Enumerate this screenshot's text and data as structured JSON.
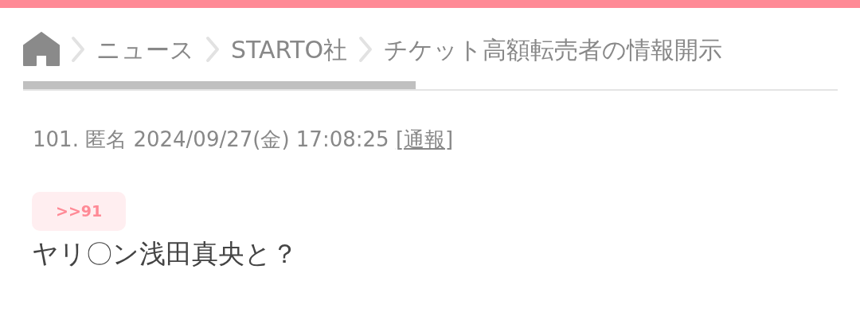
{
  "breadcrumb": [
    {
      "kind": "home"
    },
    {
      "kind": "link",
      "label": "ニュース"
    },
    {
      "kind": "link",
      "label": "STARTO社"
    },
    {
      "kind": "text",
      "label": "チケット高額転売者の情報開示"
    }
  ],
  "post": {
    "number": "101.",
    "author": "匿名",
    "datetime": "2024/09/27(金) 17:08:25",
    "report_link": "[通報]",
    "reply_anchor": ">>91",
    "body": "ヤリ〇ン浅田真央と？"
  }
}
